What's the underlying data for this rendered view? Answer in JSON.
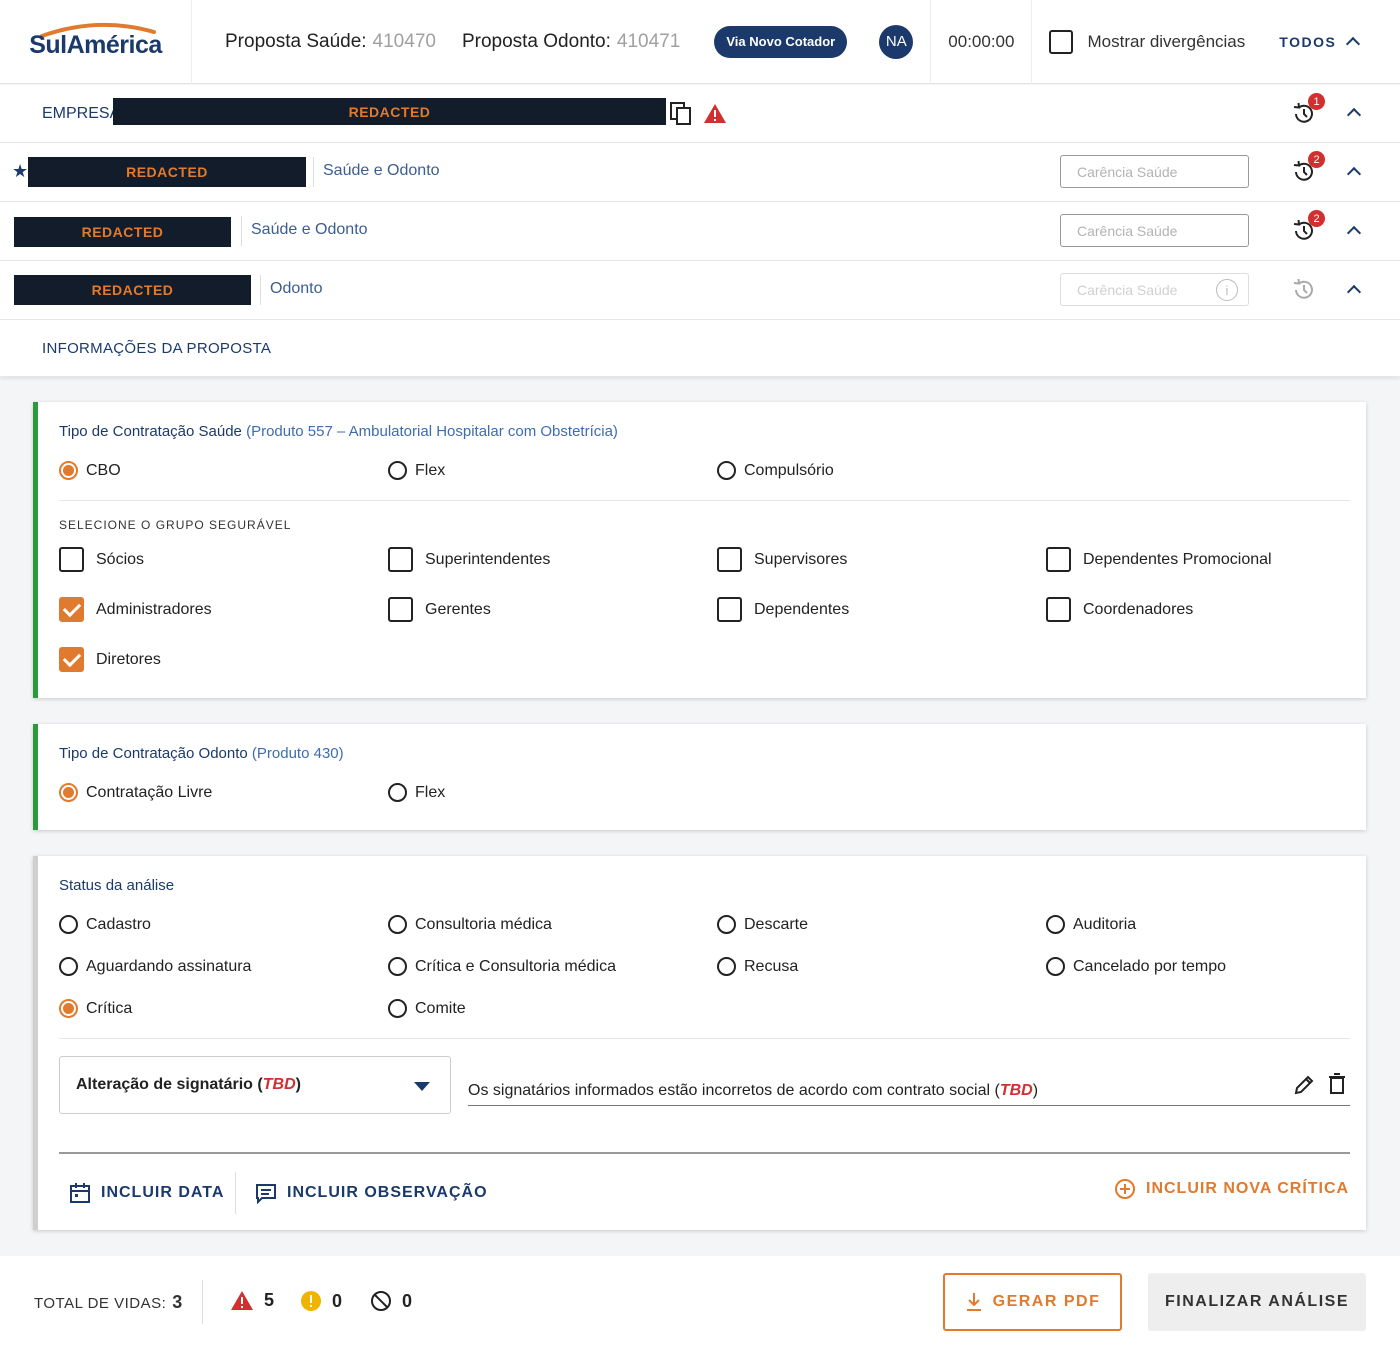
{
  "header": {
    "logo": "SulAmérica",
    "proposta_saude_label": "Proposta Saúde:",
    "proposta_saude_num": "410470",
    "proposta_odonto_label": "Proposta Odonto:",
    "proposta_odonto_num": "410471",
    "pill": "Via Novo Cotador",
    "avatar": "NA",
    "timer": "00:00:00",
    "mostrar_divergencias": "Mostrar divergências",
    "todos": "TODOS"
  },
  "empresa": {
    "label": "EMPRESA",
    "redacted": "REDACTED",
    "history_badge": "1"
  },
  "beneficiarios": [
    {
      "redacted": "REDACTED",
      "tipo": "Saúde e Odonto",
      "carencia_placeholder": "Carência Saúde",
      "badge": "2",
      "titular": true
    },
    {
      "redacted": "REDACTED",
      "tipo": "Saúde e Odonto",
      "carencia_placeholder": "Carência Saúde",
      "badge": "2",
      "titular": false
    },
    {
      "redacted": "REDACTED",
      "tipo": "Odonto",
      "carencia_placeholder": "Carência Saúde",
      "badge": "",
      "titular": false
    }
  ],
  "info_proposta": "INFORMAÇÕES DA PROPOSTA",
  "saude": {
    "title": "Tipo de Contratação Saúde",
    "produto": "(Produto 557 – Ambulatorial Hospitalar com Obstetrícia)",
    "options": [
      "CBO",
      "Flex",
      "Compulsório"
    ],
    "selected": "CBO",
    "grupo_label": "SELECIONE O GRUPO SEGURÁVEL",
    "grupos": [
      {
        "label": "Sócios",
        "checked": false
      },
      {
        "label": "Superintendentes",
        "checked": false
      },
      {
        "label": "Supervisores",
        "checked": false
      },
      {
        "label": "Dependentes Promocional",
        "checked": false
      },
      {
        "label": "Administradores",
        "checked": true
      },
      {
        "label": "Gerentes",
        "checked": false
      },
      {
        "label": "Dependentes",
        "checked": false
      },
      {
        "label": "Coordenadores",
        "checked": false
      },
      {
        "label": "Diretores",
        "checked": true
      }
    ]
  },
  "odonto": {
    "title": "Tipo de Contratação Odonto",
    "produto": "(Produto 430)",
    "options": [
      "Contratação Livre",
      "Flex"
    ],
    "selected": "Contratação Livre"
  },
  "status": {
    "title": "Status da análise",
    "options": [
      "Cadastro",
      "Consultoria médica",
      "Descarte",
      "Auditoria",
      "Aguardando assinatura",
      "Crítica e Consultoria médica",
      "Recusa",
      "Cancelado por tempo",
      "Crítica",
      "Comite"
    ],
    "selected": "Crítica",
    "critica_select": "Alteração de signatário",
    "critica_select_tag": "TBD",
    "observacao": "Os signatários informados estão incorretos de acordo com contrato social",
    "observacao_tag": "TBD",
    "incluir_data": "INCLUIR DATA",
    "incluir_observacao": "INCLUIR OBSERVAÇÃO",
    "incluir_nova_critica": "INCLUIR NOVA CRÍTICA"
  },
  "footer": {
    "total_vidas_label": "TOTAL DE VIDAS:",
    "total_vidas": "3",
    "alertas": "5",
    "avisos": "0",
    "bloqueios": "0",
    "gerar_pdf": "GERAR PDF",
    "finalizar": "FINALIZAR ANÁLISE"
  },
  "colors": {
    "navy": "#1b3a6b",
    "orange": "#e07a2e",
    "green": "#2a9a3a",
    "red": "#d0302f",
    "yellow": "#f0b400"
  }
}
